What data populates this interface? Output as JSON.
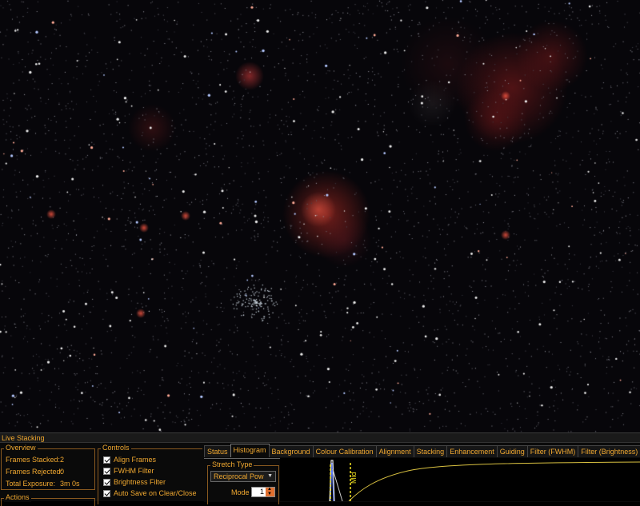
{
  "panel": {
    "title": "Live Stacking"
  },
  "overview": {
    "label": "Overview",
    "rows": [
      {
        "label": "Frames Stacked:",
        "value": "2"
      },
      {
        "label": "Frames Rejected:",
        "value": "0"
      },
      {
        "label": "Total Exposure:",
        "value": "3m 0s"
      }
    ]
  },
  "actions": {
    "label": "Actions"
  },
  "controls": {
    "label": "Controls",
    "items": [
      {
        "label": "Align Frames",
        "checked": true
      },
      {
        "label": "FWHM Filter",
        "checked": true
      },
      {
        "label": "Brightness Filter",
        "checked": true
      },
      {
        "label": "Auto Save on Clear/Close",
        "checked": true
      }
    ]
  },
  "tabs": [
    {
      "label": "Status",
      "active": false
    },
    {
      "label": "Histogram",
      "active": true
    },
    {
      "label": "Background",
      "active": false
    },
    {
      "label": "Colour Calibration",
      "active": false
    },
    {
      "label": "Alignment",
      "active": false
    },
    {
      "label": "Stacking",
      "active": false
    },
    {
      "label": "Enhancement",
      "active": false
    },
    {
      "label": "Guiding",
      "active": false
    },
    {
      "label": "Filter (FWHM)",
      "active": false
    },
    {
      "label": "Filter (Brightness)",
      "active": false
    }
  ],
  "stretch": {
    "label": "Stretch Type",
    "selected": "Reciprocal Pow",
    "mode_label": "Mode",
    "mode_value": "1"
  },
  "histogram": {
    "marker_label": "Mid"
  },
  "colors": {
    "accent": "#f0a830",
    "curve": "#d8c040",
    "marker": "#f0e020"
  }
}
